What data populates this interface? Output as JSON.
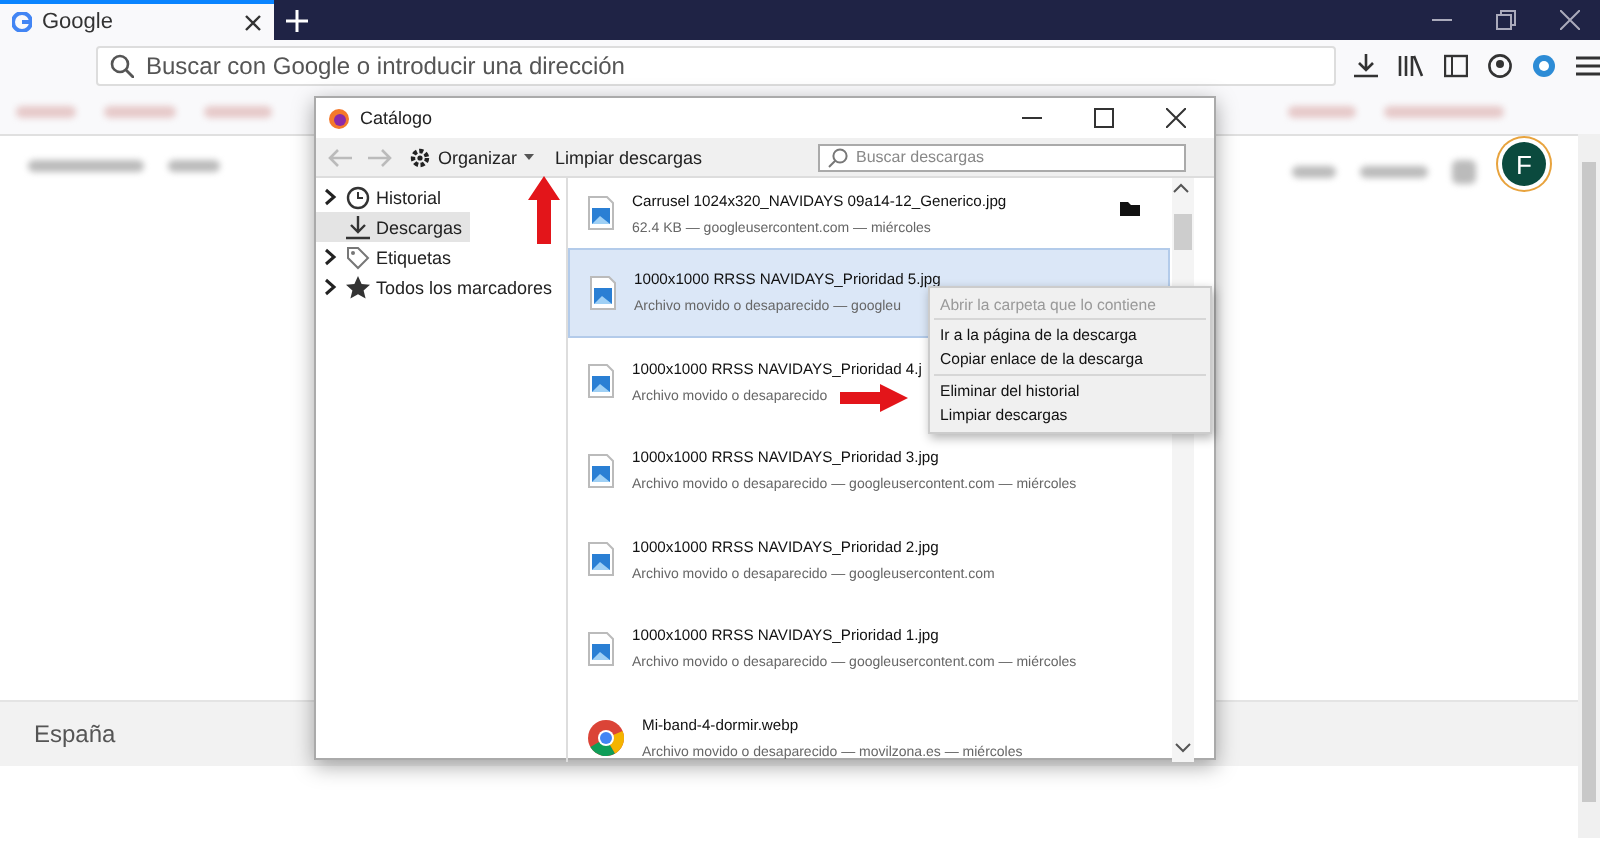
{
  "browser": {
    "tab": {
      "title": "Google"
    },
    "address_placeholder": "Buscar con Google o introducir una dirección",
    "avatar": "F",
    "footer": "España"
  },
  "dialog": {
    "title": "Catálogo",
    "organize": "Organizar",
    "clear": "Limpiar descargas",
    "search_placeholder": "Buscar descargas",
    "sidebar": [
      {
        "label": "Historial",
        "kind": "history",
        "expanded": false,
        "selected": false
      },
      {
        "label": "Descargas",
        "kind": "downloads",
        "selected": true
      },
      {
        "label": "Etiquetas",
        "kind": "tags",
        "expanded": false,
        "selected": false
      },
      {
        "label": "Todos los marcadores",
        "kind": "bookmarks",
        "expanded": false,
        "selected": false
      }
    ],
    "downloads": [
      {
        "name": "Carrusel 1024x320_NAVIDAYS 09a14-12_Generico.jpg",
        "details": "62.4 KB — googleusercontent.com — miércoles",
        "kind": "image",
        "selected": false
      },
      {
        "name": "1000x1000 RRSS NAVIDAYS_Prioridad 5.jpg",
        "details": "Archivo movido o desaparecido — googleu",
        "kind": "image",
        "selected": true
      },
      {
        "name": "1000x1000 RRSS NAVIDAYS_Prioridad 4.j",
        "details": "Archivo movido o desaparecido",
        "kind": "image",
        "selected": false
      },
      {
        "name": "1000x1000 RRSS NAVIDAYS_Prioridad 3.jpg",
        "details": "Archivo movido o desaparecido — googleusercontent.com — miércoles",
        "kind": "image",
        "selected": false
      },
      {
        "name": "1000x1000 RRSS NAVIDAYS_Prioridad 2.jpg",
        "details": "Archivo movido o desaparecido — googleusercontent.com",
        "kind": "image",
        "selected": false
      },
      {
        "name": "1000x1000 RRSS NAVIDAYS_Prioridad 1.jpg",
        "details": "Archivo movido o desaparecido — googleusercontent.com — miércoles",
        "kind": "image",
        "selected": false
      },
      {
        "name": "Mi-band-4-dormir.webp",
        "details": "Archivo movido o desaparecido — movilzona.es — miércoles",
        "kind": "webp",
        "selected": false
      }
    ],
    "context_menu": [
      {
        "label": "Abrir la carpeta que lo contiene",
        "disabled": true
      },
      {
        "label": "Ir a la página de la descarga",
        "disabled": false
      },
      {
        "label": "Copiar enlace de la descarga",
        "disabled": false
      },
      {
        "label": "Eliminar del historial",
        "disabled": false
      },
      {
        "label": "Limpiar descargas",
        "disabled": false
      }
    ]
  }
}
